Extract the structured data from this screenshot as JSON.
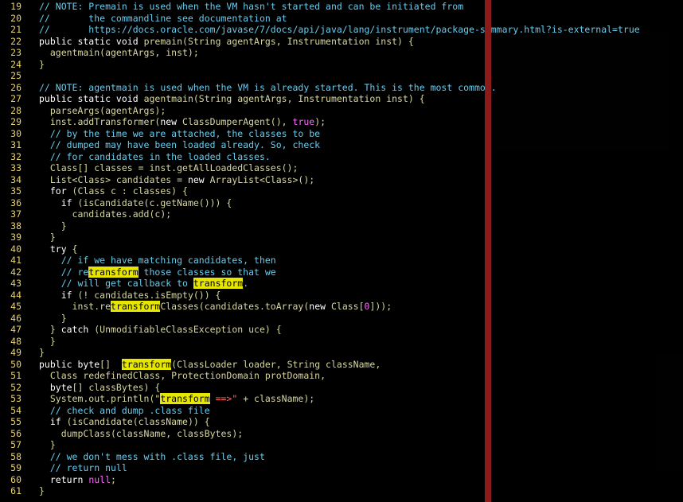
{
  "editor": {
    "lines": [
      {
        "n": "19",
        "segments": [
          {
            "t": "// NOTE: Premain is used when the VM hasn't started and can be initiated from",
            "c": "cm"
          }
        ]
      },
      {
        "n": "20",
        "segments": [
          {
            "t": "//       the commandline see documentation at",
            "c": "cm"
          }
        ]
      },
      {
        "n": "21",
        "segments": [
          {
            "t": "//       https://docs.oracle.com/javase/7/docs/api/java/lang/instrument/package-summary.html?is-external=true",
            "c": "cm"
          }
        ]
      },
      {
        "n": "22",
        "segments": [
          {
            "t": "public static void ",
            "c": "kw"
          },
          {
            "t": "premain(String agentArgs, Instrumentation inst) {",
            "c": "default"
          }
        ]
      },
      {
        "n": "23",
        "segments": [
          {
            "t": "  agentmain(agentArgs, inst);",
            "c": "default"
          }
        ]
      },
      {
        "n": "24",
        "segments": [
          {
            "t": "}",
            "c": "default"
          }
        ]
      },
      {
        "n": "25",
        "segments": [
          {
            "t": "",
            "c": "default"
          }
        ]
      },
      {
        "n": "26",
        "segments": [
          {
            "t": "// NOTE: agentmain is used when the VM is already started. This is the most common.",
            "c": "cm"
          }
        ]
      },
      {
        "n": "27",
        "segments": [
          {
            "t": "public static void ",
            "c": "kw"
          },
          {
            "t": "agentmain(String agentArgs, Instrumentation inst) {",
            "c": "default"
          }
        ]
      },
      {
        "n": "28",
        "segments": [
          {
            "t": "  parseArgs(agentArgs);",
            "c": "default"
          }
        ]
      },
      {
        "n": "29",
        "segments": [
          {
            "t": "  inst.addTransformer(",
            "c": "default"
          },
          {
            "t": "new ",
            "c": "kw"
          },
          {
            "t": "ClassDumperAgent(), ",
            "c": "default"
          },
          {
            "t": "true",
            "c": "bool"
          },
          {
            "t": ");",
            "c": "default"
          }
        ]
      },
      {
        "n": "30",
        "segments": [
          {
            "t": "  // by the time we are attached, the classes to be",
            "c": "cm"
          }
        ]
      },
      {
        "n": "31",
        "segments": [
          {
            "t": "  // dumped may have been loaded already. So, check",
            "c": "cm"
          }
        ]
      },
      {
        "n": "32",
        "segments": [
          {
            "t": "  // for candidates in the loaded classes.",
            "c": "cm"
          }
        ]
      },
      {
        "n": "33",
        "segments": [
          {
            "t": "  Class[] classes = inst.getAllLoadedClasses();",
            "c": "default"
          }
        ]
      },
      {
        "n": "34",
        "segments": [
          {
            "t": "  List<Class> candidates = ",
            "c": "default"
          },
          {
            "t": "new ",
            "c": "kw"
          },
          {
            "t": "ArrayList<Class>();",
            "c": "default"
          }
        ]
      },
      {
        "n": "35",
        "segments": [
          {
            "t": "  for ",
            "c": "kw"
          },
          {
            "t": "(Class c : classes) {",
            "c": "default"
          }
        ]
      },
      {
        "n": "36",
        "segments": [
          {
            "t": "    if ",
            "c": "kw"
          },
          {
            "t": "(isCandidate(c.getName())) {",
            "c": "default"
          }
        ]
      },
      {
        "n": "37",
        "segments": [
          {
            "t": "      candidates.add(c);",
            "c": "default"
          }
        ]
      },
      {
        "n": "38",
        "segments": [
          {
            "t": "    }",
            "c": "default"
          }
        ]
      },
      {
        "n": "39",
        "segments": [
          {
            "t": "  }",
            "c": "default"
          }
        ]
      },
      {
        "n": "40",
        "segments": [
          {
            "t": "  try ",
            "c": "kw"
          },
          {
            "t": "{",
            "c": "default"
          }
        ]
      },
      {
        "n": "41",
        "segments": [
          {
            "t": "    // if we have matching candidates, then",
            "c": "cm"
          }
        ]
      },
      {
        "n": "42",
        "segments": [
          {
            "t": "    // re",
            "c": "cm"
          },
          {
            "t": "transform",
            "c": "hl"
          },
          {
            "t": " those classes so that we",
            "c": "cm"
          }
        ]
      },
      {
        "n": "43",
        "segments": [
          {
            "t": "    // will get callback to ",
            "c": "cm"
          },
          {
            "t": "transform",
            "c": "hl"
          },
          {
            "t": ".",
            "c": "cm"
          }
        ]
      },
      {
        "n": "44",
        "segments": [
          {
            "t": "    if ",
            "c": "kw"
          },
          {
            "t": "(! candidates.isEmpty()) {",
            "c": "default"
          }
        ]
      },
      {
        "n": "45",
        "segments": [
          {
            "t": "      inst.re",
            "c": "default"
          },
          {
            "t": "transform",
            "c": "hl"
          },
          {
            "t": "Classes(candidates.toArray(",
            "c": "default"
          },
          {
            "t": "new ",
            "c": "kw"
          },
          {
            "t": "Class[",
            "c": "default"
          },
          {
            "t": "0",
            "c": "bool"
          },
          {
            "t": "]));",
            "c": "default"
          }
        ]
      },
      {
        "n": "46",
        "segments": [
          {
            "t": "    }",
            "c": "default"
          }
        ]
      },
      {
        "n": "47",
        "segments": [
          {
            "t": "  } ",
            "c": "default"
          },
          {
            "t": "catch ",
            "c": "kw"
          },
          {
            "t": "(UnmodifiableClassException uce) {",
            "c": "default"
          }
        ]
      },
      {
        "n": "48",
        "segments": [
          {
            "t": "  }",
            "c": "default"
          }
        ]
      },
      {
        "n": "49",
        "segments": [
          {
            "t": "}",
            "c": "default"
          }
        ]
      },
      {
        "n": "50",
        "segments": [
          {
            "t": "public byte",
            "c": "kw"
          },
          {
            "t": "[]  ",
            "c": "default"
          },
          {
            "t": "transform",
            "c": "hl"
          },
          {
            "t": "(ClassLoader loader, String className,",
            "c": "default"
          }
        ]
      },
      {
        "n": "51",
        "segments": [
          {
            "t": "  Class redefinedClass, ProtectionDomain protDomain,",
            "c": "default"
          }
        ]
      },
      {
        "n": "52",
        "segments": [
          {
            "t": "  byte",
            "c": "kw"
          },
          {
            "t": "[] classBytes) {",
            "c": "default"
          }
        ]
      },
      {
        "n": "53",
        "segments": [
          {
            "t": "  System.out.println(\"",
            "c": "default"
          },
          {
            "t": "transform",
            "c": "hl"
          },
          {
            "t": " ==>\"",
            "c": "str"
          },
          {
            "t": " + className);",
            "c": "default"
          }
        ]
      },
      {
        "n": "54",
        "segments": [
          {
            "t": "  // check and dump .class file",
            "c": "cm"
          }
        ]
      },
      {
        "n": "55",
        "segments": [
          {
            "t": "  if ",
            "c": "kw"
          },
          {
            "t": "(isCandidate(className)) {",
            "c": "default"
          }
        ]
      },
      {
        "n": "56",
        "segments": [
          {
            "t": "    dumpClass(className, classBytes);",
            "c": "default"
          }
        ]
      },
      {
        "n": "57",
        "segments": [
          {
            "t": "  }",
            "c": "default"
          }
        ]
      },
      {
        "n": "58",
        "segments": [
          {
            "t": "  // we don't mess with .class file, just",
            "c": "cm"
          }
        ]
      },
      {
        "n": "59",
        "segments": [
          {
            "t": "  // return null",
            "c": "cm"
          }
        ]
      },
      {
        "n": "60",
        "segments": [
          {
            "t": "  return ",
            "c": "kw"
          },
          {
            "t": "null",
            "c": "bool"
          },
          {
            "t": ";",
            "c": "default"
          }
        ]
      },
      {
        "n": "61",
        "segments": [
          {
            "t": "}",
            "c": "default"
          }
        ]
      }
    ]
  }
}
